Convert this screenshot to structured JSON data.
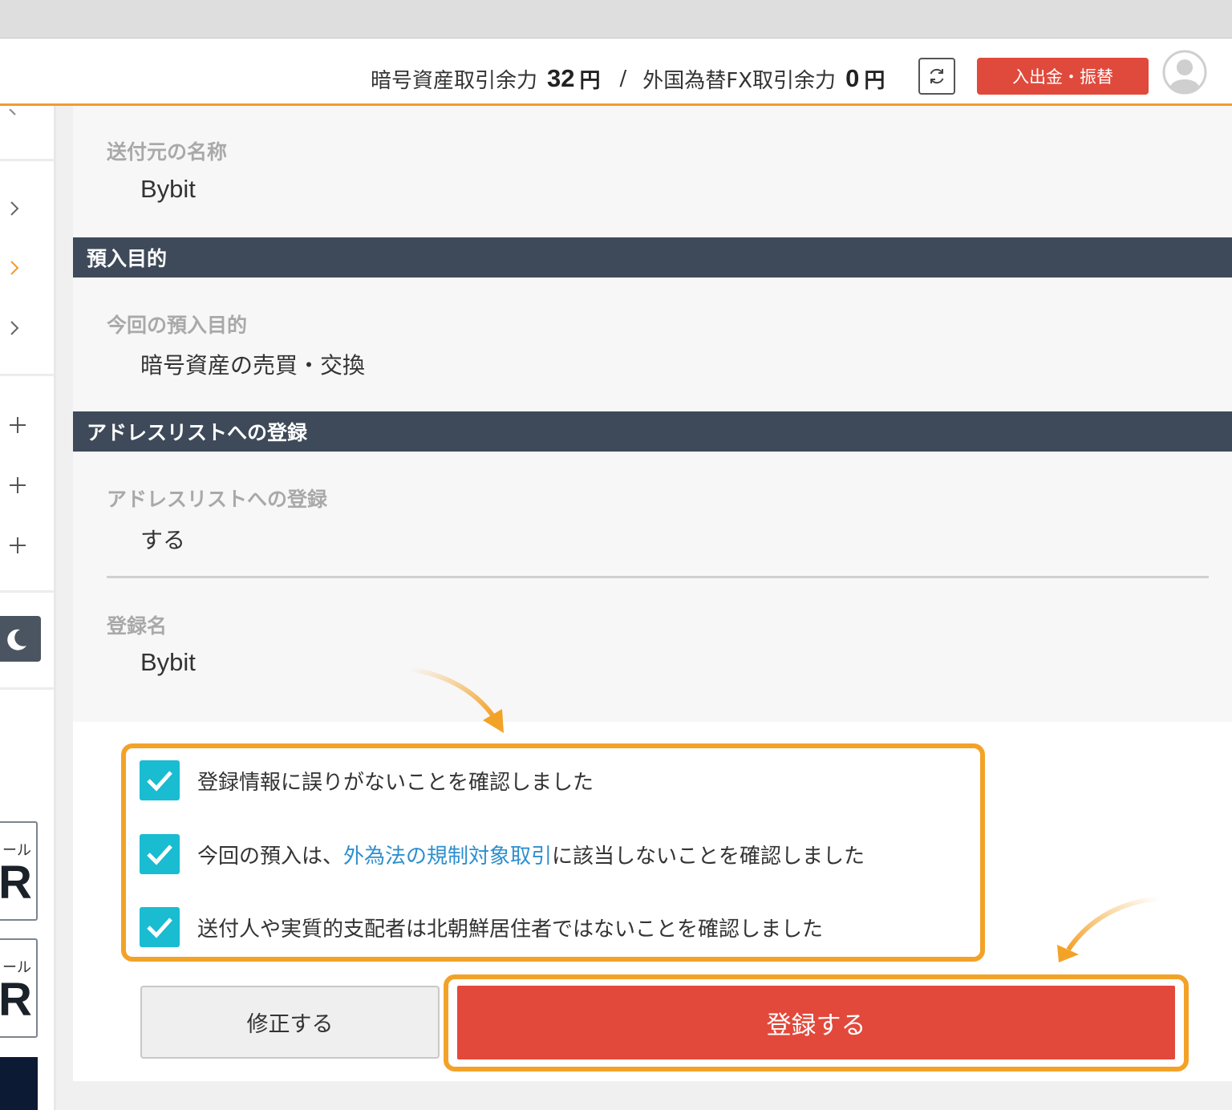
{
  "header": {
    "crypto_label": "暗号資産取引余力",
    "crypto_amount": "32",
    "crypto_unit": "円",
    "separator": "/",
    "fx_label": "外国為替FX取引余力",
    "fx_amount": "0",
    "fx_unit": "円",
    "refresh_icon": "refresh-icon",
    "deposit_button": "入出金・振替",
    "avatar_icon": "user-avatar-icon"
  },
  "sidebar": {
    "chevron_icon": "chevron-right-icon",
    "plus_icon": "plus-icon",
    "moon_icon": "moon-icon",
    "banners": [
      {
        "small": "ール",
        "big": "R"
      },
      {
        "small": "ール",
        "big": "R"
      }
    ],
    "active_color": "#f29a2e"
  },
  "sections": {
    "sender": {
      "label": "送付元の名称",
      "value": "Bybit"
    },
    "purpose": {
      "header": "預入目的",
      "label": "今回の預入目的",
      "value": "暗号資産の売買・交換"
    },
    "address_list": {
      "header": "アドレスリストへの登録",
      "register_label": "アドレスリストへの登録",
      "register_value": "する",
      "name_label": "登録名",
      "name_value": "Bybit"
    }
  },
  "checks": [
    {
      "checked": true,
      "text": "登録情報に誤りがないことを確認しました"
    },
    {
      "checked": true,
      "text_before": "今回の預入は、",
      "link": "外為法の規制対象取引",
      "text_after": "に該当しないことを確認しました"
    },
    {
      "checked": true,
      "text": "送付人や実質的支配者は北朝鮮居住者ではないことを確認しました"
    }
  ],
  "buttons": {
    "edit": "修正する",
    "submit": "登録する"
  },
  "colors": {
    "accent_orange": "#f29a2e",
    "section_header": "#3e4a59",
    "checkbox": "#19bcd0",
    "primary_red": "#e2493b",
    "link_blue": "#2d8fcf"
  }
}
